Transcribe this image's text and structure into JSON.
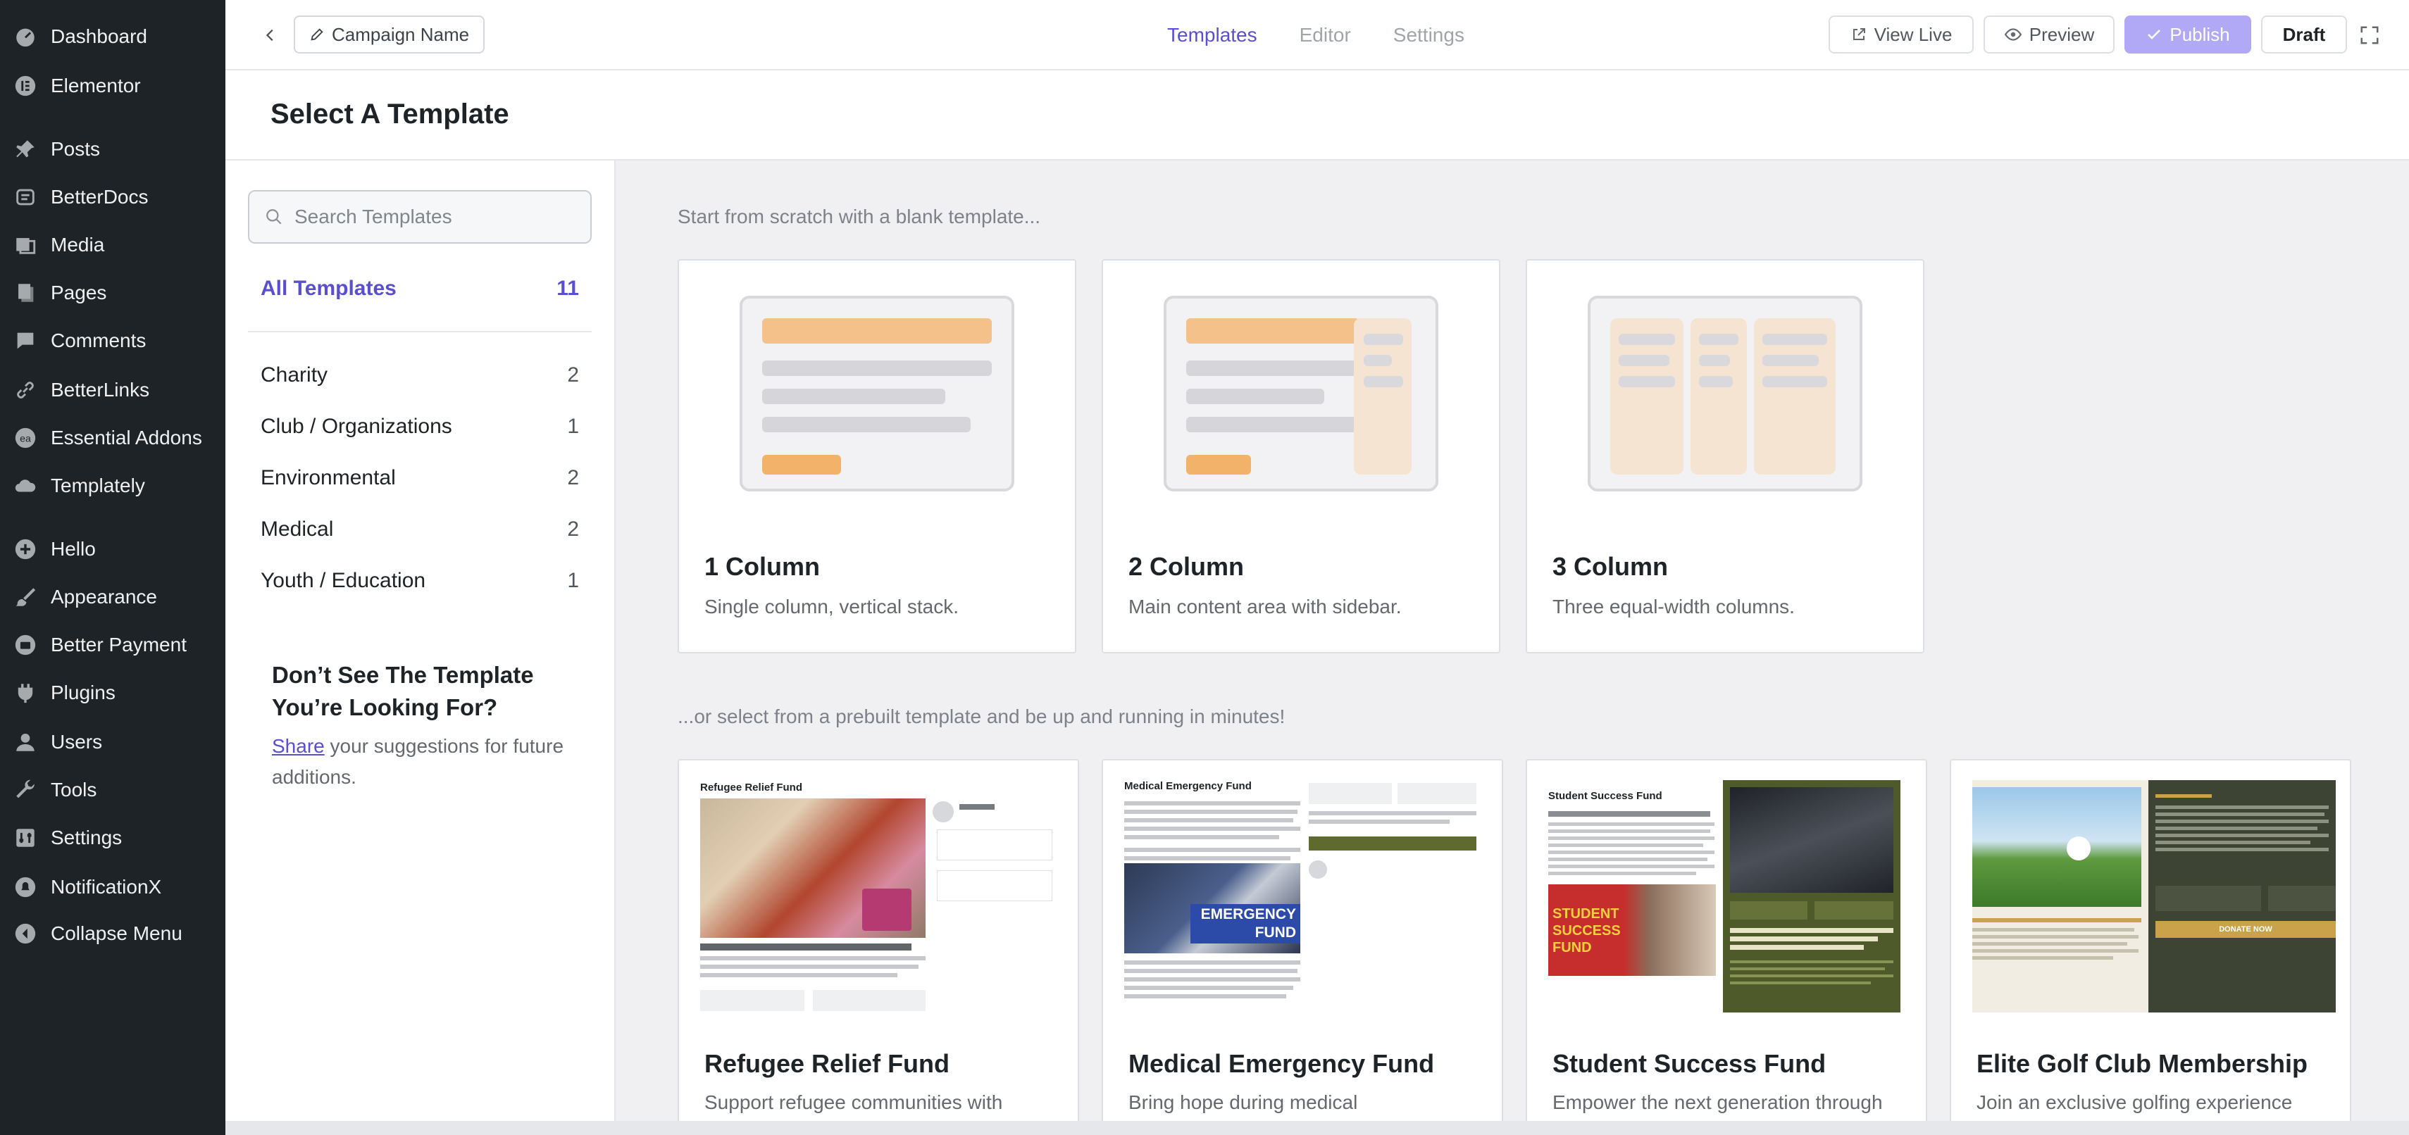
{
  "wp_sidebar": {
    "items": [
      {
        "label": "Dashboard",
        "icon": "dashboard-icon"
      },
      {
        "label": "Elementor",
        "icon": "elementor-icon"
      },
      {
        "label": "Posts",
        "icon": "pin-icon"
      },
      {
        "label": "BetterDocs",
        "icon": "docs-icon"
      },
      {
        "label": "Media",
        "icon": "media-icon"
      },
      {
        "label": "Pages",
        "icon": "pages-icon"
      },
      {
        "label": "Comments",
        "icon": "comment-icon"
      },
      {
        "label": "BetterLinks",
        "icon": "link-icon"
      },
      {
        "label": "Essential Addons",
        "icon": "ea-icon"
      },
      {
        "label": "Templately",
        "icon": "cloud-icon"
      },
      {
        "label": "Hello",
        "icon": "plus-circle-icon"
      },
      {
        "label": "Appearance",
        "icon": "brush-icon"
      },
      {
        "label": "Better Payment",
        "icon": "wallet-icon"
      },
      {
        "label": "Plugins",
        "icon": "plug-icon"
      },
      {
        "label": "Users",
        "icon": "user-icon"
      },
      {
        "label": "Tools",
        "icon": "wrench-icon"
      },
      {
        "label": "Settings",
        "icon": "settings-icon"
      },
      {
        "label": "NotificationX",
        "icon": "bell-icon"
      },
      {
        "label": "Collapse Menu",
        "icon": "collapse-icon"
      }
    ]
  },
  "topbar": {
    "campaign_name": "Campaign Name",
    "tabs": [
      "Templates",
      "Editor",
      "Settings"
    ],
    "view_live": "View Live",
    "preview": "Preview",
    "publish": "Publish",
    "draft": "Draft"
  },
  "page": {
    "title": "Select A Template"
  },
  "filters": {
    "search_placeholder": "Search Templates",
    "all": {
      "label": "All Templates",
      "count": "11"
    },
    "categories": [
      {
        "label": "Charity",
        "count": "2"
      },
      {
        "label": "Club / Organizations",
        "count": "1"
      },
      {
        "label": "Environmental",
        "count": "2"
      },
      {
        "label": "Medical",
        "count": "2"
      },
      {
        "label": "Youth / Education",
        "count": "1"
      }
    ],
    "suggest_title": "Don’t See The Template You’re Looking For?",
    "suggest_link": "Share",
    "suggest_rest": " your suggestions for future additions."
  },
  "main": {
    "blank_intro": "Start from scratch with a blank template...",
    "prebuilt_intro": "...or select from a prebuilt template and be up and running in minutes!",
    "layouts": [
      {
        "title": "1 Column",
        "desc": "Single column, vertical stack."
      },
      {
        "title": "2 Column",
        "desc": "Main content area with sidebar."
      },
      {
        "title": "3 Column",
        "desc": "Three equal-width columns."
      }
    ],
    "templates": [
      {
        "title": "Refugee Relief Fund",
        "desc": "Support refugee communities with",
        "thumb_heading": "Refugee Relief Fund"
      },
      {
        "title": "Medical Emergency Fund",
        "desc": "Bring hope during medical",
        "thumb_heading": "Medical Emergency Fund",
        "thumb_badge": "EMERGENCY FUND"
      },
      {
        "title": "Student Success Fund",
        "desc": "Empower the next generation through",
        "thumb_heading": "Student Success Fund",
        "thumb_badge": "STUDENT SUCCESS FUND"
      },
      {
        "title": "Elite Golf Club Membership",
        "desc": "Join an exclusive golfing experience",
        "thumb_button": "DONATE NOW"
      }
    ]
  },
  "colors": {
    "accent": "#5a4fcf",
    "publish_bg": "#b1a9f5",
    "wp_sidebar_bg": "#1d2327"
  }
}
